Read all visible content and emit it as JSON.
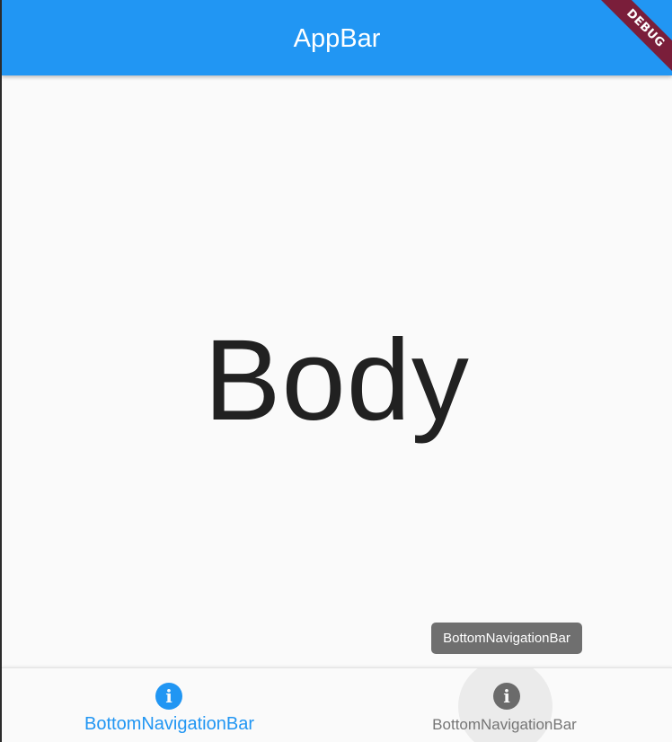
{
  "app_bar": {
    "title": "AppBar"
  },
  "debug_banner": {
    "label": "DEBUG"
  },
  "body": {
    "text": "Body"
  },
  "tooltip": {
    "text": "BottomNavigationBar"
  },
  "bottom_navigation": {
    "items": [
      {
        "label": "BottomNavigationBar",
        "icon": "info-icon",
        "selected": true
      },
      {
        "label": "BottomNavigationBar",
        "icon": "info-icon",
        "selected": false
      }
    ]
  },
  "colors": {
    "primary": "#2196f3",
    "debug_banner": "#7a1e3a",
    "inactive": "#757575",
    "tooltip": "#6f6f6f"
  }
}
